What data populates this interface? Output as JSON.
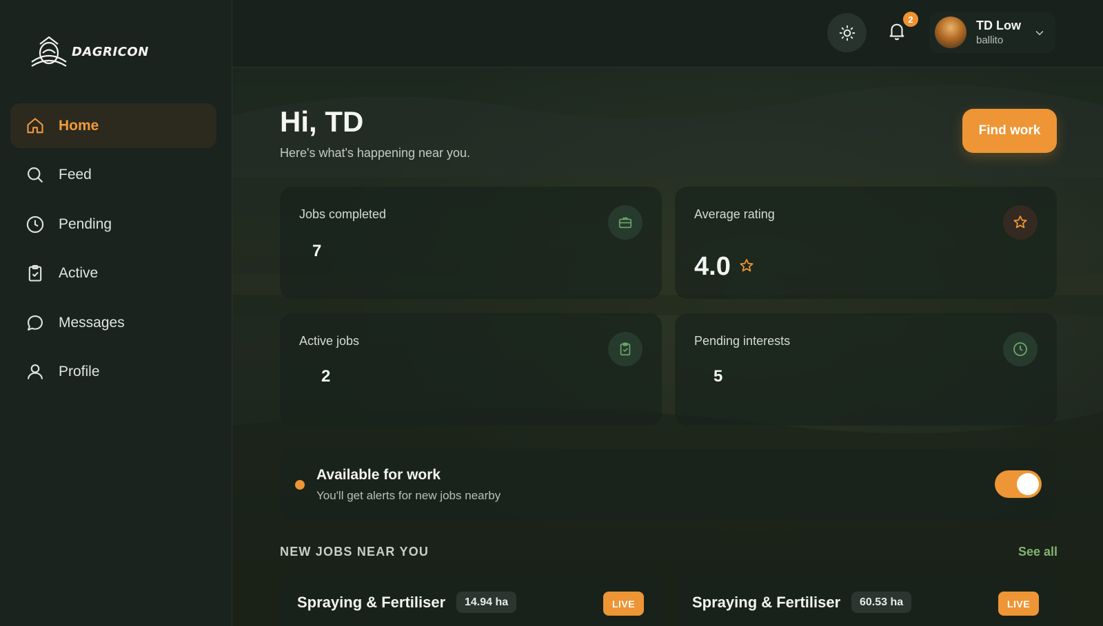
{
  "brand": {
    "name": "DAGRICON"
  },
  "nav": {
    "items": [
      {
        "label": "Home",
        "icon": "home-icon",
        "active": true
      },
      {
        "label": "Feed",
        "icon": "search-icon"
      },
      {
        "label": "Pending",
        "icon": "clock-icon"
      },
      {
        "label": "Active",
        "icon": "clipboard-check-icon"
      },
      {
        "label": "Messages",
        "icon": "chat-bubble-icon"
      },
      {
        "label": "Profile",
        "icon": "user-icon"
      }
    ]
  },
  "topbar": {
    "notifications_count": "2",
    "user": {
      "name": "TD Low",
      "location": "ballito"
    }
  },
  "header": {
    "greeting": "Hi, TD",
    "subtitle": "Here's what's happening near you.",
    "find_work_label": "Find work"
  },
  "stats": {
    "jobs_completed": {
      "label": "Jobs completed",
      "value": "7",
      "icon": "briefcase-icon"
    },
    "average_rating": {
      "label": "Average rating",
      "value": "4.0",
      "icon": "star-icon"
    },
    "active_jobs": {
      "label": "Active jobs",
      "value": "2",
      "icon": "clipboard-check-icon"
    },
    "pending_interests": {
      "label": "Pending interests",
      "value": "5",
      "icon": "clock-icon"
    }
  },
  "availability": {
    "title": "Available for work",
    "subtitle": "You'll get alerts for new jobs nearby",
    "enabled": true
  },
  "jobs_section": {
    "title": "NEW JOBS NEAR YOU",
    "see_all_label": "See all",
    "jobs": [
      {
        "title": "Spraying & Fertiliser",
        "area": "14.94 ha",
        "status": "LIVE"
      },
      {
        "title": "Spraying & Fertiliser",
        "area": "60.53 ha",
        "status": "LIVE"
      }
    ]
  },
  "colors": {
    "accent": "#ee9535",
    "link_green": "#84b470",
    "background": "#17201b"
  }
}
